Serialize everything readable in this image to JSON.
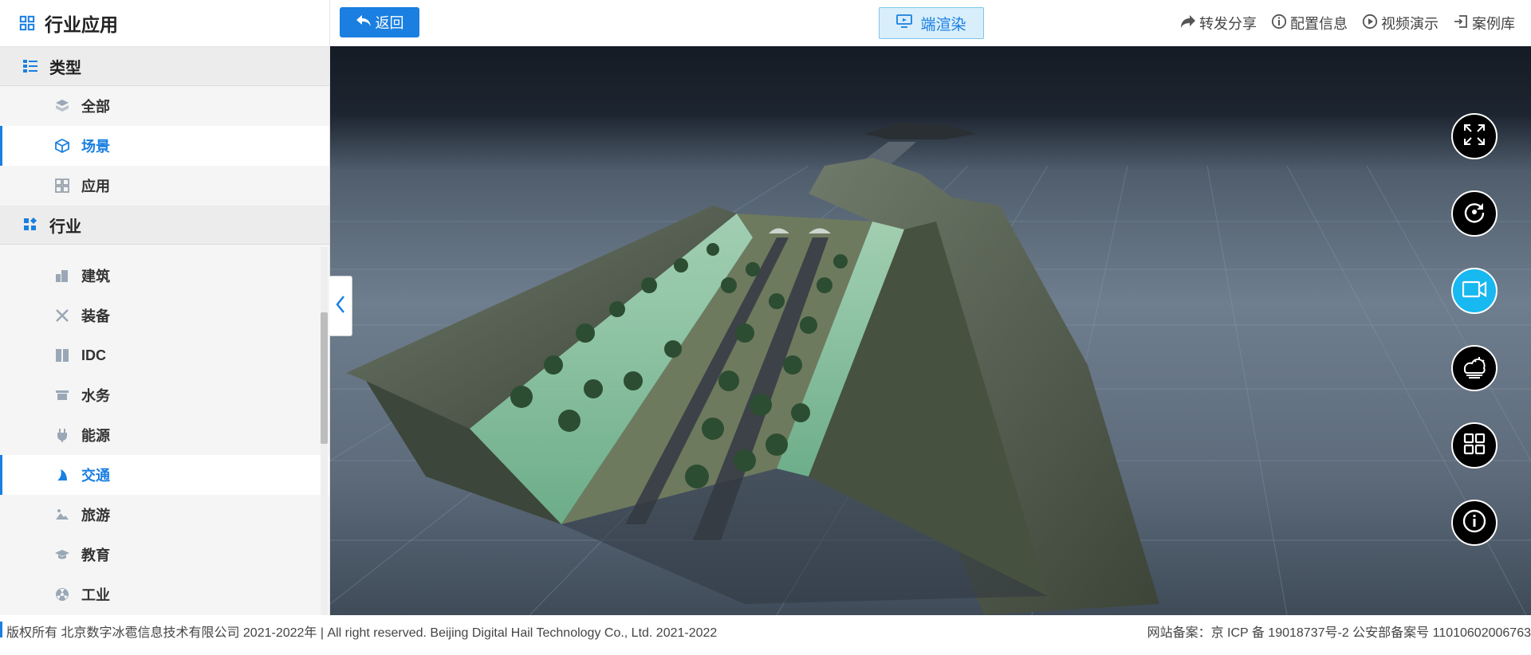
{
  "sidebar": {
    "title": "行业应用",
    "title_icon": "grid-icon",
    "groups": [
      {
        "label": "类型",
        "icon": "list-icon",
        "items": [
          {
            "label": "全部",
            "icon": "layers-icon"
          },
          {
            "label": "场景",
            "icon": "cube-icon",
            "active": true
          },
          {
            "label": "应用",
            "icon": "apps-icon"
          }
        ]
      },
      {
        "label": "行业",
        "icon": "category-icon",
        "items": [
          {
            "label": "建筑",
            "icon": "building-icon"
          },
          {
            "label": "装备",
            "icon": "equipment-icon"
          },
          {
            "label": "IDC",
            "icon": "server-icon"
          },
          {
            "label": "水务",
            "icon": "water-icon"
          },
          {
            "label": "能源",
            "icon": "plug-icon"
          },
          {
            "label": "交通",
            "icon": "traffic-icon",
            "active": true
          },
          {
            "label": "旅游",
            "icon": "tourism-icon"
          },
          {
            "label": "教育",
            "icon": "education-icon"
          },
          {
            "label": "工业",
            "icon": "industry-icon"
          }
        ]
      }
    ]
  },
  "topbar": {
    "back_label": "返回",
    "render_label": "端渲染",
    "links": [
      {
        "label": "转发分享",
        "icon": "share-icon"
      },
      {
        "label": "配置信息",
        "icon": "info-icon"
      },
      {
        "label": "视频演示",
        "icon": "play-icon"
      },
      {
        "label": "案例库",
        "icon": "library-icon"
      }
    ]
  },
  "viewport_controls": [
    {
      "name": "fullscreen-icon"
    },
    {
      "name": "rotate-icon"
    },
    {
      "name": "video-camera-icon",
      "active": true
    },
    {
      "name": "weather-icon"
    },
    {
      "name": "layout-grid-icon"
    },
    {
      "name": "info-circle-icon"
    }
  ],
  "footer": {
    "left": "版权所有 北京数字冰雹信息技术有限公司 2021-2022年 | All right reserved. Beijing Digital Hail Technology Co., Ltd. 2021-2022",
    "right": "网站备案：京 ICP 备 19018737号-2 公安部备案号 11010602006763"
  },
  "colors": {
    "accent": "#1a7fe0",
    "active_control": "#18b8f0"
  }
}
